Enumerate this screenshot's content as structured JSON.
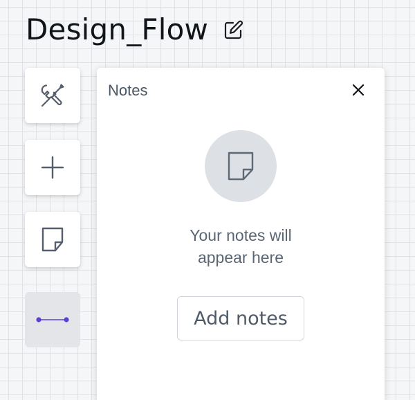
{
  "document": {
    "title": "Design_Flow",
    "edit_icon": "pencil-square-icon"
  },
  "toolbar": {
    "items": [
      {
        "name": "tools",
        "icon": "wrench-screwdriver-icon"
      },
      {
        "name": "add",
        "icon": "plus-icon"
      },
      {
        "name": "notes",
        "icon": "sticky-note-icon"
      },
      {
        "name": "connector",
        "icon": "line-connector-icon",
        "active": true,
        "color": "#5b3fd6"
      }
    ]
  },
  "notes_panel": {
    "title": "Notes",
    "close_icon": "close-icon",
    "empty_icon": "sticky-note-icon",
    "empty_message_line1": "Your notes will",
    "empty_message_line2": "appear here",
    "add_button_label": "Add notes"
  },
  "colors": {
    "canvas_bg": "#f5f6f8",
    "grid_line": "#e0e2e6",
    "accent": "#5b3fd6"
  }
}
